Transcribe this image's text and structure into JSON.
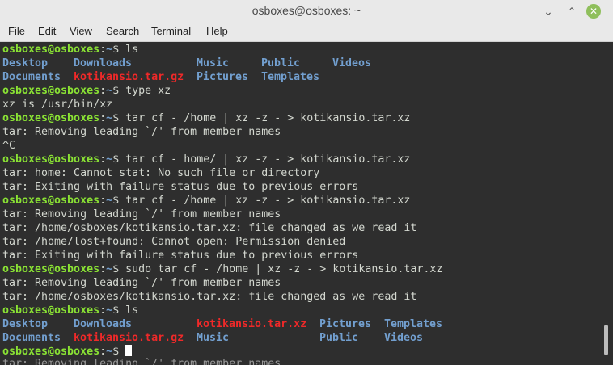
{
  "window": {
    "title": "osboxes@osboxes: ~",
    "minimize_glyph": "⌄",
    "maximize_glyph": "⌃",
    "close_glyph": "✕",
    "close_color": "#8fbf5c"
  },
  "menu": {
    "file": "File",
    "edit": "Edit",
    "view": "View",
    "search": "Search",
    "terminal": "Terminal",
    "help": "Help"
  },
  "colors": {
    "prompt": "#8ae234",
    "directory": "#729fcf",
    "archive": "#ef2929",
    "text": "#d3d7cf",
    "background": "#2e2e2e"
  },
  "prompt": {
    "user_host": "osboxes@osboxes",
    "colon": ":",
    "path": "~",
    "dollar": "$ "
  },
  "terminal": {
    "l1": {
      "cmd": "ls"
    },
    "l2": {
      "desktop": "Desktop",
      "downloads": "Downloads",
      "music": "Music",
      "public": "Public",
      "videos": "Videos"
    },
    "l3": {
      "documents": "Documents",
      "archive": "kotikansio.tar.gz",
      "pictures": "Pictures",
      "templates": "Templates"
    },
    "l4": {
      "cmd": "type xz"
    },
    "l5": {
      "text": "xz is /usr/bin/xz"
    },
    "l6": {
      "cmd": "tar cf - /home | xz -z - > kotikansio.tar.xz"
    },
    "l7": {
      "text": "tar: Removing leading `/' from member names"
    },
    "l8": {
      "text": "^C"
    },
    "l9": {
      "cmd": "tar cf - home/ | xz -z - > kotikansio.tar.xz"
    },
    "l10": {
      "text": "tar: home: Cannot stat: No such file or directory"
    },
    "l11": {
      "text": "tar: Exiting with failure status due to previous errors"
    },
    "l12": {
      "cmd": "tar cf - /home | xz -z - > kotikansio.tar.xz"
    },
    "l13": {
      "text": "tar: Removing leading `/' from member names"
    },
    "l14": {
      "text": "tar: /home/osboxes/kotikansio.tar.xz: file changed as we read it"
    },
    "l15": {
      "text": "tar: /home/lost+found: Cannot open: Permission denied"
    },
    "l16": {
      "text": "tar: Exiting with failure status due to previous errors"
    },
    "l17": {
      "cmd": "sudo tar cf - /home | xz -z - > kotikansio.tar.xz"
    },
    "l18": {
      "text": "tar: Removing leading `/' from member names"
    },
    "l19": {
      "text": "tar: /home/osboxes/kotikansio.tar.xz: file changed as we read it"
    },
    "l20": {
      "cmd": "ls"
    },
    "l21": {
      "desktop": "Desktop",
      "downloads": "Downloads",
      "archive": "kotikansio.tar.xz",
      "pictures": "Pictures",
      "templates": "Templates"
    },
    "l22": {
      "documents": "Documents",
      "archive": "kotikansio.tar.gz",
      "music": "Music",
      "public": "Public",
      "videos": "Videos"
    },
    "l23": {
      "ghost": "tar: Removing leading `/' from member names"
    }
  }
}
